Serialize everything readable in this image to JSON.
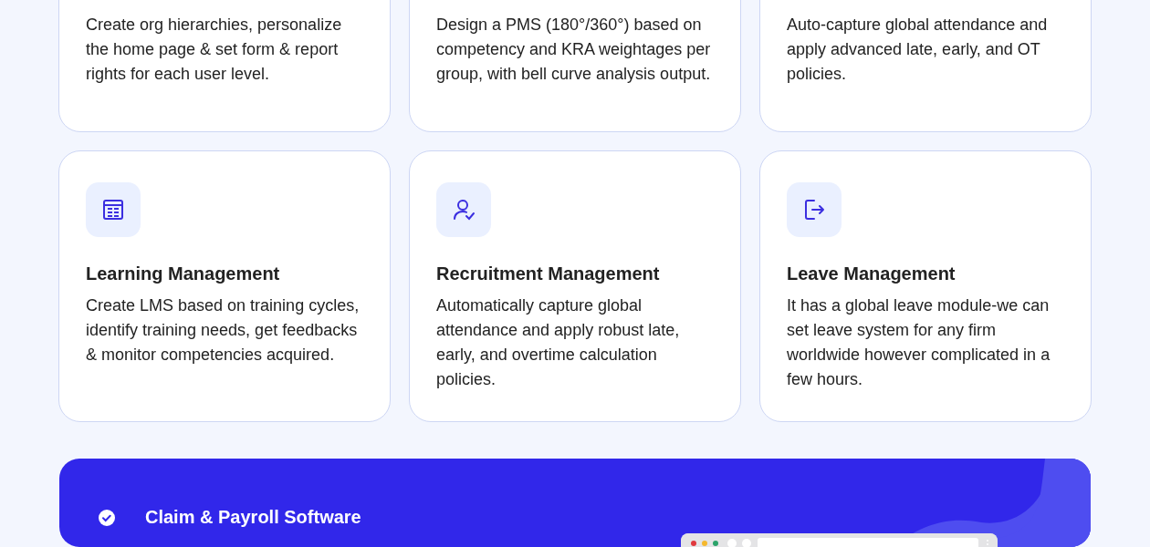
{
  "top_cards": [
    {
      "description": "Create org hierarchies, personalize the home page & set form & report rights for each user level."
    },
    {
      "description": "Design a PMS (180°/360°) based on competency and KRA weightages per group, with bell curve analysis output."
    },
    {
      "description": "Auto-capture global attendance and apply advanced late, early, and OT policies."
    }
  ],
  "cards": [
    {
      "kind": "table",
      "title": "Learning Management",
      "description": "Create LMS based on training cycles, identify training needs, get feedbacks & monitor competencies acquired."
    },
    {
      "kind": "user-check",
      "title": "Recruitment Management",
      "description": "Automatically capture global attendance and apply robust late, early, and overtime calculation policies."
    },
    {
      "kind": "exit",
      "title": "Leave Management",
      "description": "It has a global leave module-we can set leave system for any firm worldwide however complicated in a few hours."
    }
  ],
  "banner": {
    "title": "Claim & Payroll Software"
  }
}
